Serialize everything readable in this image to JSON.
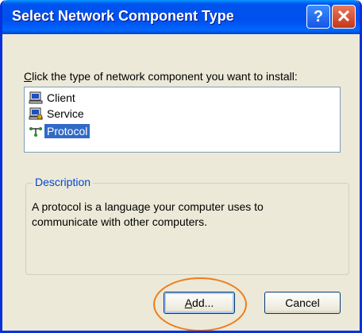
{
  "window": {
    "title": "Select Network Component Type",
    "help_label": "?",
    "close_label": "✕"
  },
  "instruction": {
    "first_letter": "C",
    "rest": "lick the type of network component you want to install:"
  },
  "list": {
    "items": [
      {
        "label": "Client",
        "icon": "client-computer-icon",
        "selected": false
      },
      {
        "label": "Service",
        "icon": "service-computer-icon",
        "selected": false
      },
      {
        "label": "Protocol",
        "icon": "protocol-network-icon",
        "selected": true
      }
    ]
  },
  "description": {
    "legend": "Description",
    "text": "A protocol is a language your computer uses to communicate with other computers."
  },
  "buttons": {
    "add_first": "A",
    "add_rest": "dd...",
    "cancel": "Cancel"
  },
  "colors": {
    "titlebar": "#0053ee",
    "selection": "#316ac5",
    "annotation_ring": "#f07c18",
    "legend": "#0046d5"
  }
}
